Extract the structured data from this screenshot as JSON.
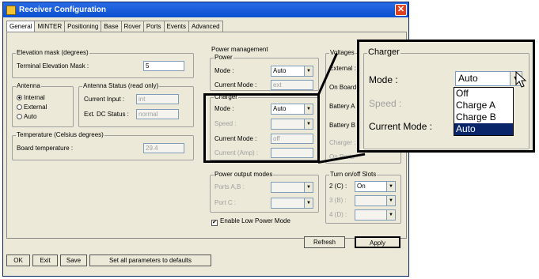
{
  "window": {
    "title": "Receiver Configuration",
    "close": "✕"
  },
  "tabs": [
    "General",
    "MINTER",
    "Positioning",
    "Base",
    "Rover",
    "Ports",
    "Events",
    "Advanced"
  ],
  "elevation": {
    "group": "Elevation mask (degrees)",
    "label": "Terminal Elevation Mask :",
    "value": "5"
  },
  "antenna": {
    "group": "Antenna",
    "options": [
      "Internal",
      "External",
      "Auto"
    ],
    "selected": "Internal"
  },
  "antenna_status": {
    "group": "Antenna Status (read only)",
    "current_input_label": "Current Input :",
    "current_input": "int",
    "ext_dc_label": "Ext. DC Status :",
    "ext_dc": "normal"
  },
  "temperature": {
    "group": "Temperature (Celsius degrees)",
    "label": "Board temperature :",
    "value": "29.4"
  },
  "power_mgmt": {
    "group": "Power management",
    "power_group": "Power",
    "mode_label": "Mode :",
    "mode": "Auto",
    "current_mode_label": "Current Mode :",
    "current_mode": "ext"
  },
  "charger": {
    "group": "Charger",
    "mode_label": "Mode :",
    "mode": "Auto",
    "speed_label": "Speed :",
    "current_mode_label": "Current Mode :",
    "current_mode": "off",
    "current_amp_label": "Current (Amp) :"
  },
  "voltages": {
    "group": "Voltages",
    "ext_label": "External :",
    "onboard_label": "On Board",
    "batt_a_label": "Battery A",
    "batt_b_label": "Battery B",
    "charger_label": "Charger :",
    "onports_label": "On Ports"
  },
  "power_output": {
    "group": "Power output modes",
    "ports_ab_label": "Ports A,B :",
    "port_c_label": "Port C :"
  },
  "turn_slots": {
    "group": "Turn on/off Slots",
    "slot2_label": "2 (C) :",
    "slot2_value": "On",
    "slot3_label": "3 (B) :",
    "slot4_label": "4 (D) :"
  },
  "low_power": {
    "label": "Enable Low Power Mode",
    "checked": "✔"
  },
  "buttons": {
    "refresh": "Refresh",
    "apply": "Apply",
    "ok": "OK",
    "exit": "Exit",
    "save": "Save",
    "defaults": "Set all parameters to defaults"
  },
  "zoom": {
    "group": "Charger",
    "mode_label": "Mode :",
    "mode": "Auto",
    "speed_label": "Speed :",
    "current_mode_label": "Current Mode :",
    "options": [
      "Off",
      "Charge A",
      "Charge B",
      "Auto"
    ],
    "highlighted": "Auto"
  }
}
